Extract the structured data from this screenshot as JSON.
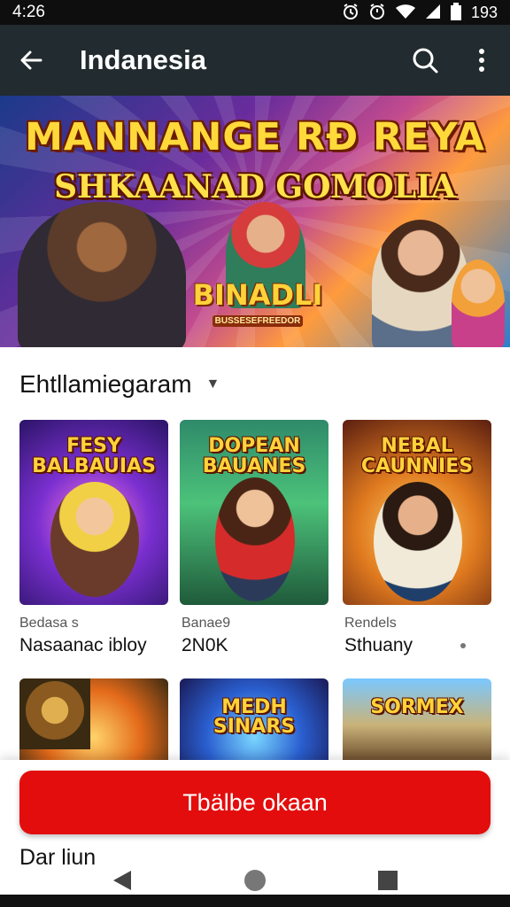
{
  "status_bar": {
    "time": "4:26",
    "battery_text": "193",
    "icons": [
      "alarm-icon",
      "alarm-icon",
      "wifi-icon",
      "signal-icon",
      "battery-icon"
    ]
  },
  "app_bar": {
    "title": "Indanesia",
    "icons": [
      "back-arrow-icon",
      "search-icon",
      "more-vert-icon"
    ]
  },
  "banner": {
    "line1": "MANNANGE RÐ REYA",
    "line2": "SHKAANAD GOMOLIA",
    "logo": "BINADLI",
    "logo_sub": "BUSSESEFREEDOR"
  },
  "section": {
    "label": "Ehtllamiegaram",
    "chevron_icon": "chevron-down-icon"
  },
  "games_row1": [
    {
      "card_title": "FESY BALBAUIAS",
      "meta": "Bedasa s",
      "name": "Nasaanac ibloy"
    },
    {
      "card_title": "DOPEAN BAUANES",
      "meta": "Banae9",
      "name": "2N0K"
    },
    {
      "card_title": "NEBAL CAUNNIES",
      "meta": "Rendels",
      "name": "Sthuany"
    }
  ],
  "games_row2": [
    {
      "card_title": ""
    },
    {
      "card_title": "MEDH SINARS"
    },
    {
      "card_title": "SORMEX"
    }
  ],
  "cta": {
    "label": "Tbälbe okaan"
  },
  "footer": {
    "text": "Dar liun"
  },
  "nav_bar": {
    "icons": [
      "back-triangle-icon",
      "home-circle-icon",
      "recents-square-icon"
    ]
  },
  "colors": {
    "app_bar": "#222b2f",
    "status_bar": "#0e0e0e",
    "cta": "#e30d0d",
    "banner_text": "#ffd93a"
  }
}
